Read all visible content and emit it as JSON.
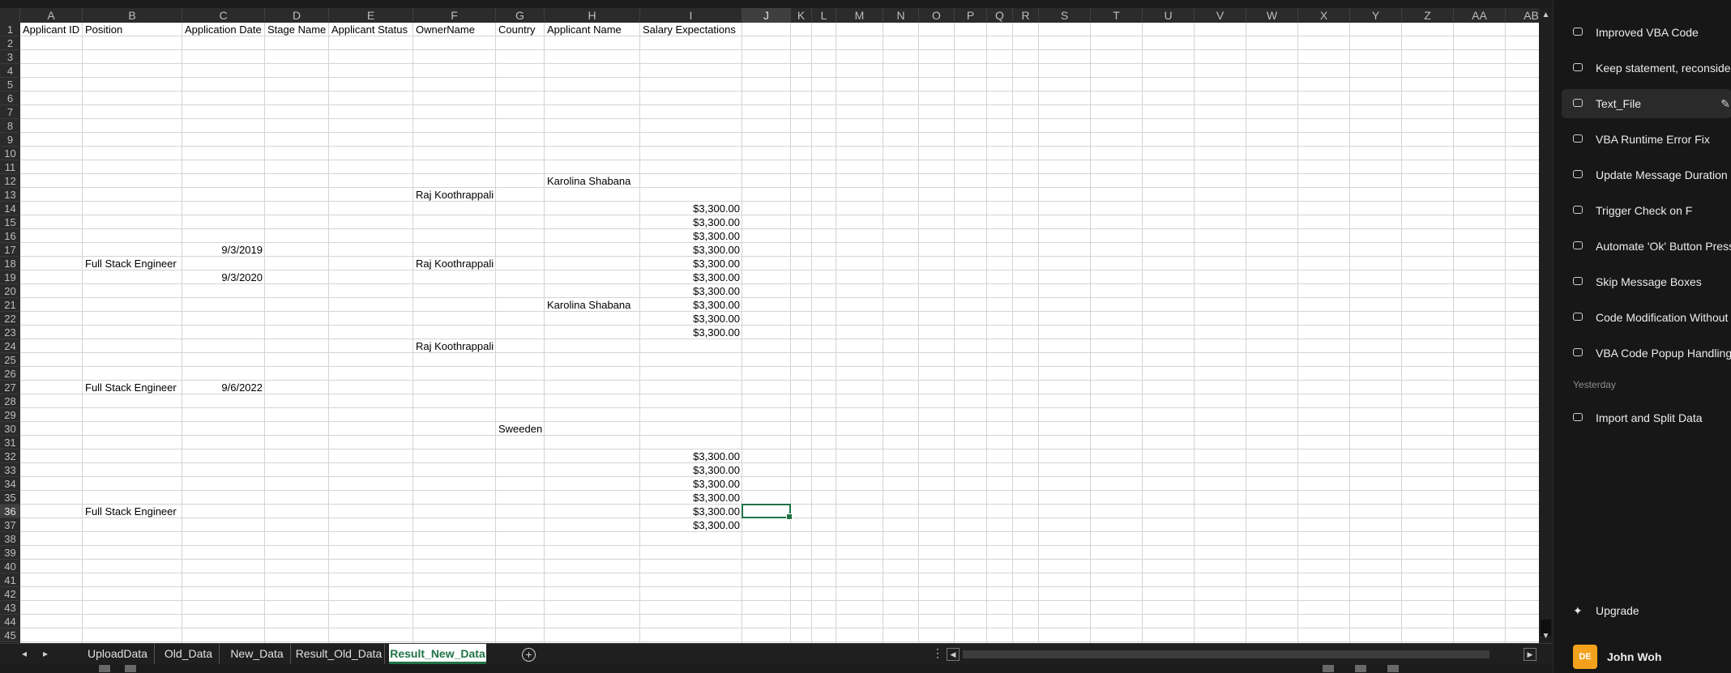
{
  "sheet": {
    "columns": [
      "A",
      "B",
      "C",
      "D",
      "E",
      "F",
      "G",
      "H",
      "I",
      "J",
      "K",
      "L",
      "M",
      "N",
      "O",
      "P",
      "Q",
      "R",
      "S",
      "T",
      "U",
      "V",
      "W",
      "X",
      "Y",
      "Z",
      "AA",
      "AB"
    ],
    "row_count": 45,
    "selected_cell": "J36",
    "headers": [
      "Applicant ID",
      "Position",
      "Application Date",
      "Stage Name",
      "Applicant Status",
      "OwnerName",
      "Country",
      "Applicant Name",
      "Salary Expectations"
    ],
    "cells": [
      {
        "row": 12,
        "col": "H",
        "value": "Karolina   Shabana",
        "align": "left"
      },
      {
        "row": 13,
        "col": "F",
        "value": "Raj Koothrappali",
        "align": "left"
      },
      {
        "row": 14,
        "col": "I",
        "value": "$3,300.00",
        "align": "right"
      },
      {
        "row": 15,
        "col": "I",
        "value": "$3,300.00",
        "align": "right"
      },
      {
        "row": 16,
        "col": "I",
        "value": "$3,300.00",
        "align": "right"
      },
      {
        "row": 17,
        "col": "C",
        "value": "9/3/2019",
        "align": "right"
      },
      {
        "row": 17,
        "col": "I",
        "value": "$3,300.00",
        "align": "right"
      },
      {
        "row": 18,
        "col": "B",
        "value": "Full Stack Engineer",
        "align": "left"
      },
      {
        "row": 18,
        "col": "F",
        "value": "Raj Koothrappali",
        "align": "left"
      },
      {
        "row": 18,
        "col": "I",
        "value": "$3,300.00",
        "align": "right"
      },
      {
        "row": 19,
        "col": "C",
        "value": "9/3/2020",
        "align": "right"
      },
      {
        "row": 19,
        "col": "I",
        "value": "$3,300.00",
        "align": "right"
      },
      {
        "row": 20,
        "col": "I",
        "value": "$3,300.00",
        "align": "right"
      },
      {
        "row": 21,
        "col": "H",
        "value": "Karolina   Shabana",
        "align": "left"
      },
      {
        "row": 21,
        "col": "I",
        "value": "$3,300.00",
        "align": "right"
      },
      {
        "row": 22,
        "col": "I",
        "value": "$3,300.00",
        "align": "right"
      },
      {
        "row": 23,
        "col": "I",
        "value": "$3,300.00",
        "align": "right"
      },
      {
        "row": 24,
        "col": "F",
        "value": "Raj Koothrappali",
        "align": "left"
      },
      {
        "row": 27,
        "col": "B",
        "value": "Full Stack Engineer",
        "align": "left"
      },
      {
        "row": 27,
        "col": "C",
        "value": "9/6/2022",
        "align": "right"
      },
      {
        "row": 30,
        "col": "G",
        "value": "Sweeden",
        "align": "left"
      },
      {
        "row": 32,
        "col": "I",
        "value": "$3,300.00",
        "align": "right"
      },
      {
        "row": 33,
        "col": "I",
        "value": "$3,300.00",
        "align": "right"
      },
      {
        "row": 34,
        "col": "I",
        "value": "$3,300.00",
        "align": "right"
      },
      {
        "row": 35,
        "col": "I",
        "value": "$3,300.00",
        "align": "right"
      },
      {
        "row": 36,
        "col": "B",
        "value": "Full Stack Engineer",
        "align": "left"
      },
      {
        "row": 36,
        "col": "I",
        "value": "$3,300.00",
        "align": "right"
      },
      {
        "row": 37,
        "col": "I",
        "value": "$3,300.00",
        "align": "right"
      }
    ]
  },
  "tabs": [
    {
      "label": "UploadData",
      "active": false
    },
    {
      "label": "Old_Data",
      "active": false
    },
    {
      "label": "New_Data",
      "active": false
    },
    {
      "label": "Result_Old_Data",
      "active": false
    },
    {
      "label": "Result_New_Data",
      "active": true
    }
  ],
  "chat": {
    "items": [
      {
        "label": "Improved VBA Code",
        "hover": false
      },
      {
        "label": "Keep statement, reconsider",
        "hover": false
      },
      {
        "label": "Text_File",
        "hover": true
      },
      {
        "label": "VBA Runtime Error Fix",
        "hover": false
      },
      {
        "label": "Update Message Duration",
        "hover": false
      },
      {
        "label": "Trigger Check on F",
        "hover": false
      },
      {
        "label": "Automate 'Ok' Button Press",
        "hover": false
      },
      {
        "label": "Skip Message Boxes",
        "hover": false
      },
      {
        "label": "Code Modification Without",
        "hover": false
      },
      {
        "label": "VBA Code Popup Handling",
        "hover": false
      }
    ],
    "section_yesterday": "Yesterday",
    "yesterday_items": [
      {
        "label": "Import and Split Data",
        "hover": false
      }
    ],
    "upgrade_label": "Upgrade",
    "user": {
      "initials": "DE",
      "name": "John Woh"
    },
    "accent": "#f4a21d"
  },
  "colors": {
    "excel_green": "#217346",
    "grid_line": "#d4d4d4"
  }
}
